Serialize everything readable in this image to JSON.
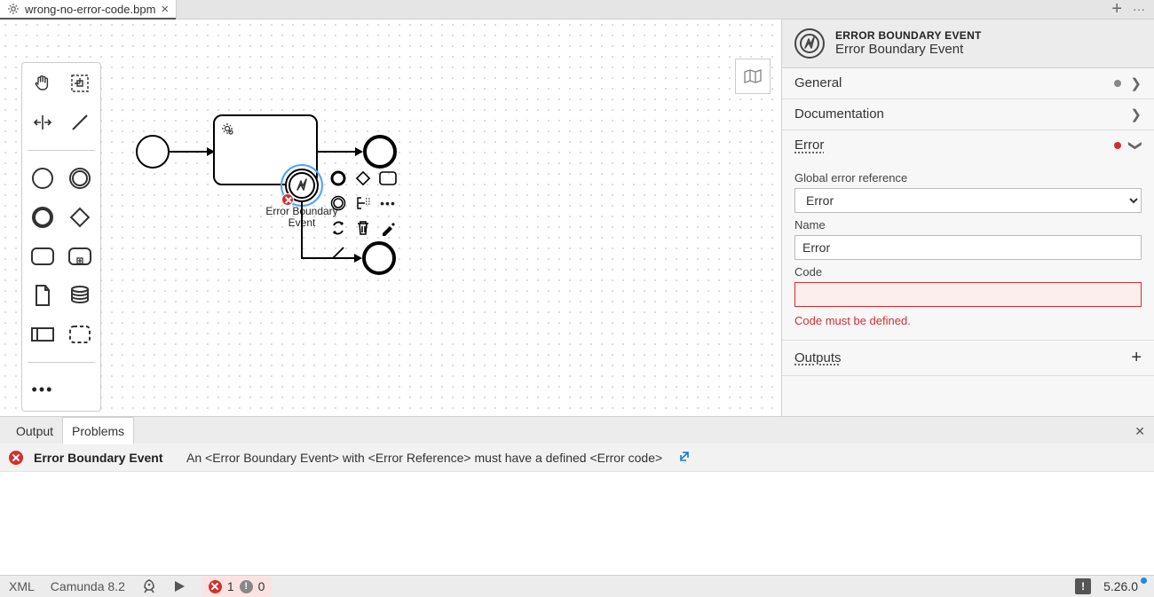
{
  "tab": {
    "title": "wrong-no-error-code.bpm"
  },
  "canvas": {
    "element_label": "Error Boundary\nEvent"
  },
  "properties": {
    "kind": "ERROR BOUNDARY EVENT",
    "name": "Error Boundary Event",
    "sections": {
      "general": "General",
      "documentation": "Documentation",
      "error": "Error",
      "outputs": "Outputs"
    },
    "error": {
      "global_ref_label": "Global error reference",
      "global_ref_value": "Error",
      "name_label": "Name",
      "name_value": "Error",
      "code_label": "Code",
      "code_value": "",
      "code_err": "Code must be defined."
    }
  },
  "bottom_tabs": {
    "output": "Output",
    "problems": "Problems"
  },
  "problems": [
    {
      "where": "Error Boundary Event",
      "message": "An <Error Boundary Event> with <Error Reference> must have a defined <Error code>"
    }
  ],
  "status": {
    "xml": "XML",
    "platform": "Camunda 8.2",
    "errors": "1",
    "warnings": "0",
    "version": "5.26.0"
  }
}
